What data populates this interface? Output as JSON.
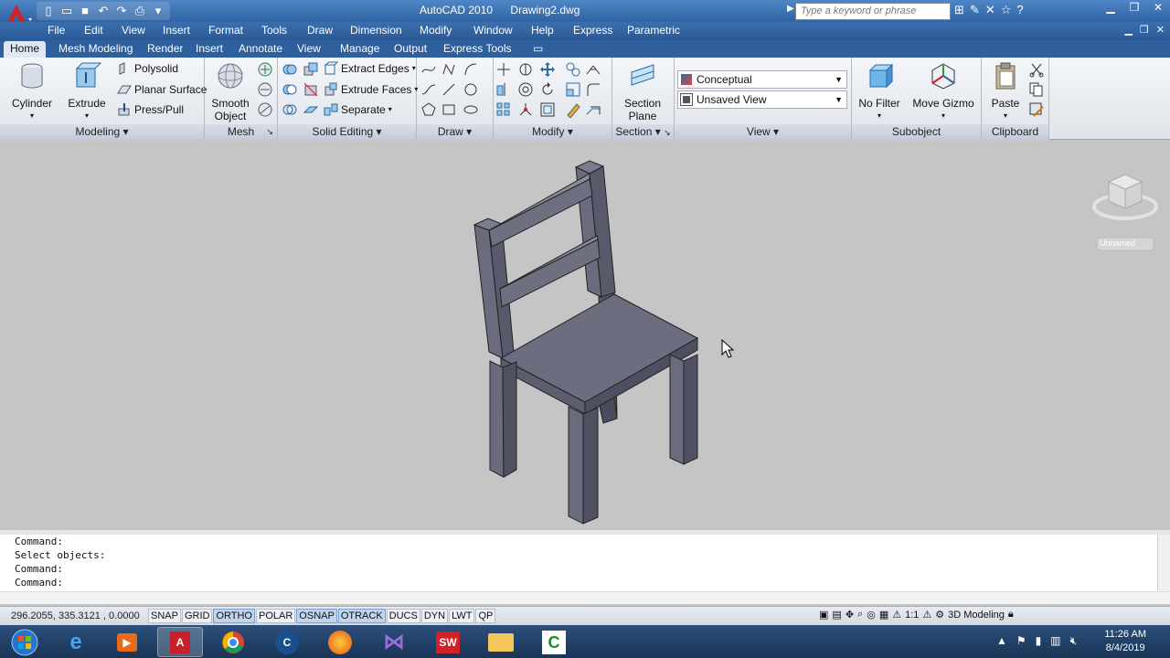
{
  "window": {
    "title": "AutoCAD 2010",
    "document": "Drawing2.dwg",
    "search_placeholder": "Type a keyword or phrase"
  },
  "menu": [
    "File",
    "Edit",
    "View",
    "Insert",
    "Format",
    "Tools",
    "Draw",
    "Dimension",
    "Modify",
    "Window",
    "Help",
    "Express",
    "Parametric"
  ],
  "tabs": [
    "Home",
    "Mesh Modeling",
    "Render",
    "Insert",
    "Annotate",
    "View",
    "Manage",
    "Output",
    "Express Tools"
  ],
  "ribbon": {
    "modeling": {
      "title": "Modeling",
      "cylinder": "Cylinder",
      "extrude": "Extrude",
      "polysolid": "Polysolid",
      "planar_surface": "Planar Surface",
      "press_pull": "Press/Pull"
    },
    "mesh": {
      "title": "Mesh",
      "smooth_object_l1": "Smooth",
      "smooth_object_l2": "Object"
    },
    "solid_editing": {
      "title": "Solid Editing",
      "extract_edges": "Extract Edges",
      "extrude_faces": "Extrude Faces",
      "separate": "Separate"
    },
    "draw": {
      "title": "Draw"
    },
    "modify": {
      "title": "Modify"
    },
    "section": {
      "title": "Section",
      "section_plane_l1": "Section",
      "section_plane_l2": "Plane"
    },
    "view": {
      "title": "View",
      "visual_style": "Conceptual",
      "named_view": "Unsaved View"
    },
    "subobject": {
      "title": "Subobject",
      "no_filter": "No Filter",
      "move_gizmo": "Move Gizmo"
    },
    "clipboard": {
      "title": "Clipboard",
      "paste": "Paste"
    }
  },
  "viewcube": {
    "label": "Unnamed"
  },
  "command_lines": [
    "Command:",
    "Select objects:",
    "Command:",
    "Command:"
  ],
  "status": {
    "coords": "296.2055, 335.3121 , 0.0000",
    "toggles": [
      "SNAP",
      "GRID",
      "ORTHO",
      "POLAR",
      "OSNAP",
      "OTRACK",
      "DUCS",
      "DYN",
      "LWT",
      "QP"
    ],
    "toggles_on": [
      "ORTHO",
      "OSNAP",
      "OTRACK"
    ],
    "scale": "1:1",
    "workspace": "3D Modeling"
  },
  "taskbar": {
    "time": "11:26 AM",
    "date": "8/4/2019"
  },
  "colors": {
    "titlebar": "#2f63a3",
    "viewport": "#c5c5c5",
    "chair": "#6c6e80"
  }
}
